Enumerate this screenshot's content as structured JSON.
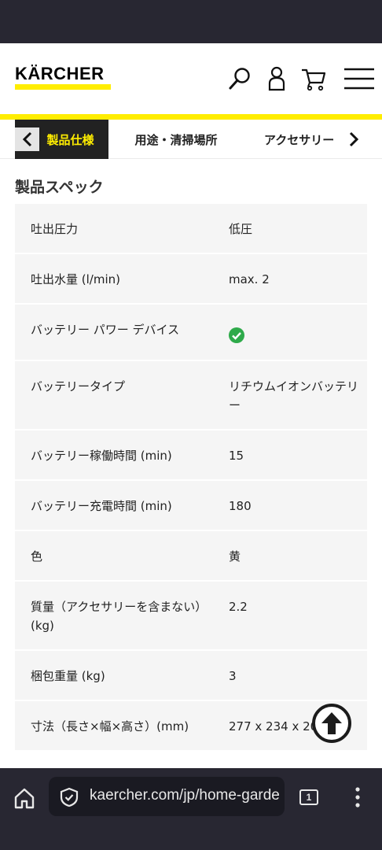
{
  "brand": {
    "logo_text": "KÄRCHER",
    "accent_color": "#ffed00"
  },
  "header_icons": [
    "search-icon",
    "account-icon",
    "cart-icon",
    "menu-icon"
  ],
  "tabs": [
    {
      "label": "製品仕様",
      "active": true
    },
    {
      "label": "用途・清掃場所",
      "active": false
    },
    {
      "label": "アクセサリー",
      "active": false
    }
  ],
  "section": {
    "title": "製品スペック"
  },
  "specs": [
    {
      "label": "吐出圧力",
      "value": "低圧"
    },
    {
      "label": "吐出水量 (l/min)",
      "value": "max. 2"
    },
    {
      "label": "バッテリー パワー デバイス",
      "value": "",
      "icon": "check-circle-icon"
    },
    {
      "label": "バッテリータイプ",
      "value": "リチウムイオンバッテリー"
    },
    {
      "label": "バッテリー稼働時間 (min)",
      "value": "15"
    },
    {
      "label": "バッテリー充電時間 (min)",
      "value": "180"
    },
    {
      "label": "色",
      "value": "黄"
    },
    {
      "label": "質量（アクセサリーを含まない）(kg)",
      "value": "2.2"
    },
    {
      "label": "梱包重量 (kg)",
      "value": "3"
    },
    {
      "label": "寸法（長さ×幅×高さ）(mm)",
      "value": "277 x 234 x 201"
    }
  ],
  "browser": {
    "url": "kaercher.com/jp/home-garde",
    "tab_count": "1"
  }
}
